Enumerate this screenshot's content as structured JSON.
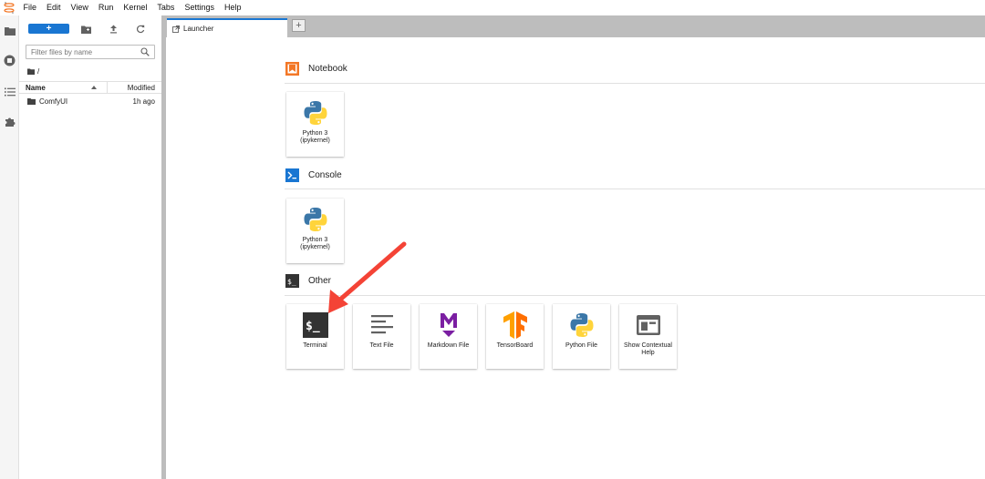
{
  "menubar": {
    "items": [
      "File",
      "Edit",
      "View",
      "Run",
      "Kernel",
      "Tabs",
      "Settings",
      "Help"
    ]
  },
  "rail": {
    "icons": [
      "folder-icon",
      "stop-circle-icon",
      "list-icon",
      "puzzle-icon"
    ]
  },
  "filebrowser": {
    "new_label": "+",
    "filter_placeholder": "Filter files by name",
    "breadcrumb": "/",
    "columns": {
      "name": "Name",
      "modified": "Modified"
    },
    "rows": [
      {
        "name": "ComfyUI",
        "modified": "1h ago"
      }
    ]
  },
  "tabs": {
    "active_label": "Launcher",
    "add_label": "+"
  },
  "launcher": {
    "sections": [
      {
        "title": "Notebook",
        "cards": [
          {
            "label": "Python 3 (ipykernel)",
            "icon": "python-icon"
          }
        ]
      },
      {
        "title": "Console",
        "cards": [
          {
            "label": "Python 3 (ipykernel)",
            "icon": "python-icon"
          }
        ]
      },
      {
        "title": "Other",
        "cards": [
          {
            "label": "Terminal",
            "icon": "terminal-icon"
          },
          {
            "label": "Text File",
            "icon": "text-file-icon"
          },
          {
            "label": "Markdown File",
            "icon": "markdown-icon"
          },
          {
            "label": "TensorBoard",
            "icon": "tensorflow-icon"
          },
          {
            "label": "Python File",
            "icon": "python-icon"
          },
          {
            "label": "Show Contextual Help",
            "icon": "contextual-help-icon"
          }
        ]
      }
    ]
  },
  "colors": {
    "accent": "#1976d2",
    "notebook": "#f37726",
    "console": "#1976d2",
    "terminal": "#333333",
    "markdown": "#7b1fa2",
    "tensorboard": "#ff8f00",
    "annotation_arrow": "#f44336"
  }
}
